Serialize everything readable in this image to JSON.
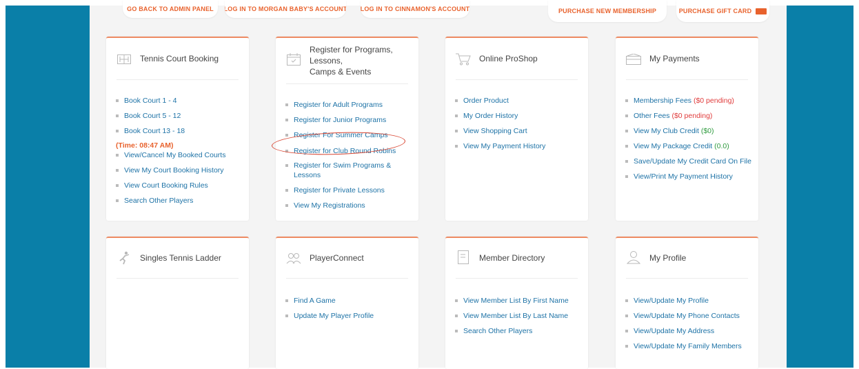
{
  "top_buttons": [
    {
      "label": "GO BACK TO ADMIN PANEL"
    },
    {
      "label": "LOG IN TO MORGAN BABY'S ACCOUNT"
    },
    {
      "label": "LOG IN TO CINNAMON'S ACCOUNT"
    },
    {
      "label": "PURCHASE NEW MEMBERSHIP"
    },
    {
      "label": "PURCHASE GIFT CARD"
    }
  ],
  "cards": {
    "tennis": {
      "title": "Tennis Court Booking",
      "icon": "court-icon",
      "links": [
        "Book Court 1 - 4",
        "Book Court 5 - 12",
        "Book Court 13 - 18"
      ],
      "time": "(Time: 08:47 AM)",
      "links2": [
        "View/Cancel My Booked Courts",
        "View My Court Booking History",
        "View Court Booking Rules",
        "Search Other Players"
      ]
    },
    "register": {
      "title_line1": "Register for Programs, Lessons,",
      "title_line2": "Camps & Events",
      "icon": "calendar-icon",
      "links": [
        "Register for Adult Programs",
        "Register for Junior Programs",
        "Register For Summer Camps",
        "Register for Club Round Robins",
        "Register for Swim Programs &",
        "Lessons",
        "Register for Private Lessons",
        "View My Registrations"
      ]
    },
    "proshop": {
      "title": "Online ProShop",
      "icon": "cart-icon",
      "links": [
        "Order Product",
        "My Order History",
        "View Shopping Cart",
        "View My Payment History"
      ]
    },
    "payments": {
      "title": "My Payments",
      "icon": "wallet-icon",
      "membership_label": "Membership Fees",
      "membership_pending": "($0 pending)",
      "other_label": "Other Fees",
      "other_pending": "($0 pending)",
      "club_credit_label": "View My Club Credit",
      "club_credit_value": "($0)",
      "package_credit_label": "View My Package Credit",
      "package_credit_value": "(0.0)",
      "links": [
        "Save/Update My Credit Card On File",
        "View/Print My Payment History"
      ]
    },
    "ladder": {
      "title": "Singles Tennis Ladder",
      "icon": "player-icon"
    },
    "playerconnect": {
      "title": "PlayerConnect",
      "icon": "people-icon",
      "links": [
        "Find A Game",
        "Update My Player Profile"
      ]
    },
    "directory": {
      "title": "Member Directory",
      "icon": "directory-icon",
      "links": [
        "View Member List By First Name",
        "View Member List By Last Name",
        "Search Other Players"
      ]
    },
    "profile": {
      "title": "My Profile",
      "icon": "user-icon",
      "links": [
        "View/Update My Profile",
        "View/Update My Phone Contacts",
        "View/Update My Address",
        "View/Update My Family Members"
      ]
    }
  },
  "colors": {
    "frame": "#0a7fa8",
    "accent": "#e8622d",
    "link": "#1d72a6",
    "pending": "#e03b3b",
    "credit": "#2e9b3e"
  }
}
